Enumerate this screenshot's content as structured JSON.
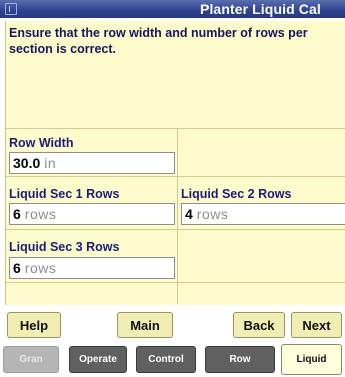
{
  "window": {
    "title": "Planter Liquid Cal",
    "menu_icon": "window-menu-icon"
  },
  "instructions": "Ensure that the row width and number of rows per section is correct.",
  "fields": {
    "row_width": {
      "label": "Row Width",
      "value": "30.0",
      "unit": "in"
    },
    "sec1": {
      "label": "Liquid Sec 1 Rows",
      "value": "6",
      "unit": "rows"
    },
    "sec2": {
      "label": "Liquid Sec 2 Rows",
      "value": "4",
      "unit": "rows"
    },
    "sec3": {
      "label": "Liquid Sec 3 Rows",
      "value": "6",
      "unit": "rows"
    }
  },
  "buttons": {
    "help": "Help",
    "main": "Main",
    "back": "Back",
    "next": "Next"
  },
  "tabs": [
    {
      "label": "Gran",
      "state": "disabled"
    },
    {
      "label": "Operate",
      "state": "normal"
    },
    {
      "label": "Control",
      "state": "normal"
    },
    {
      "label": "Row",
      "state": "normal"
    },
    {
      "label": "Liquid",
      "state": "active"
    }
  ],
  "colors": {
    "titlebar": "#2f4590",
    "panel_background": "#fdfbcc",
    "label_text": "#1b1d78",
    "button_background": "#f0eeb2",
    "tab_background": "#606060",
    "tab_active_background": "#fffddc"
  }
}
